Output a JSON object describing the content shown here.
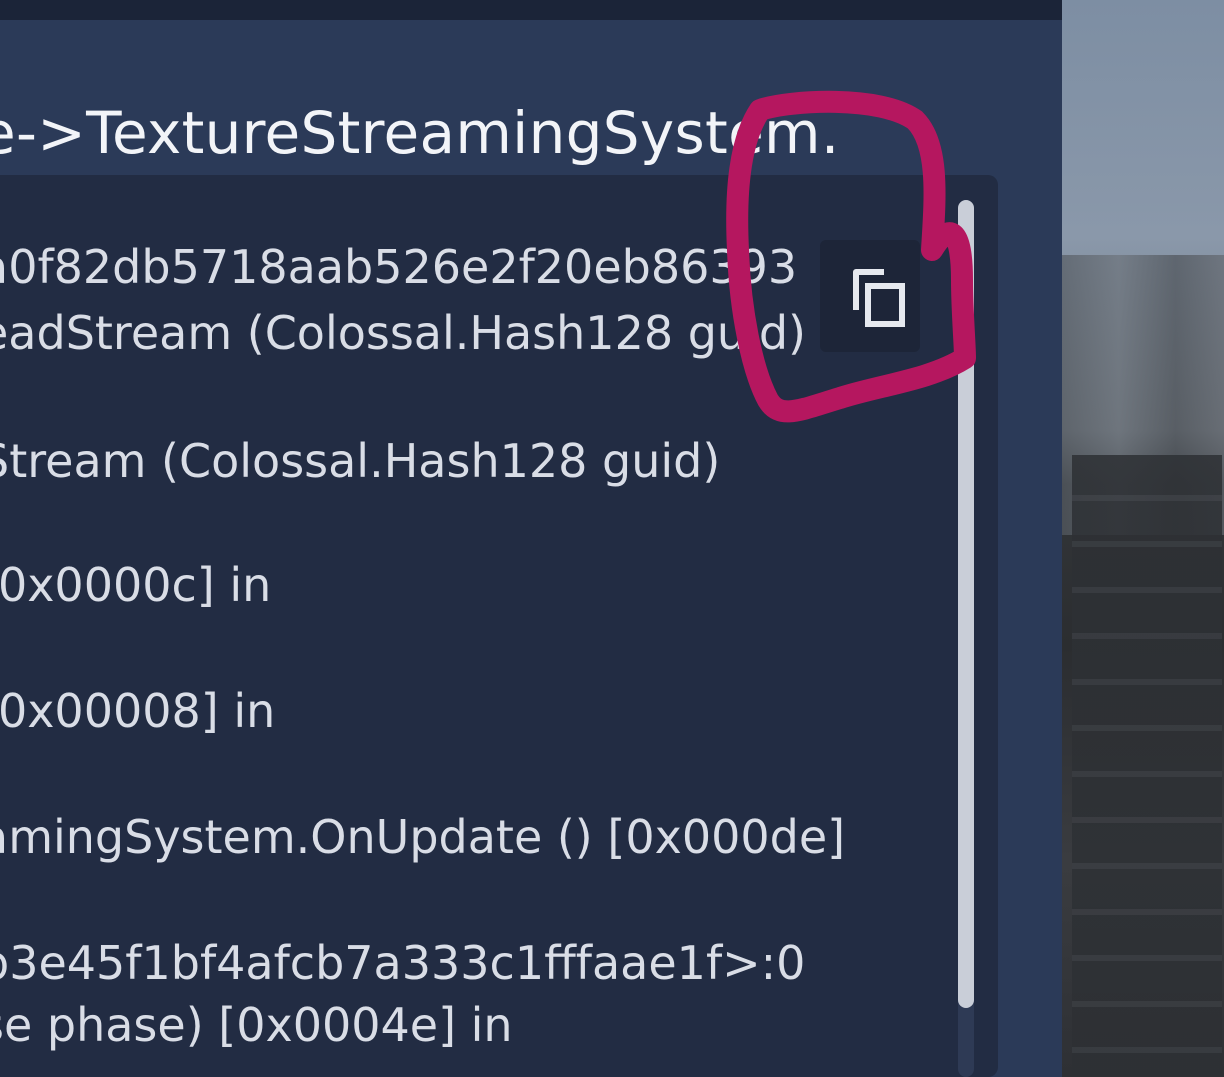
{
  "header": {
    "title": "e->TextureStreamingSystem."
  },
  "log": {
    "lines": [
      "a0f82db5718aab526e2f20eb86393",
      "eadStream (Colossal.Hash128 guid)",
      "Stream (Colossal.Hash128 guid)",
      " [0x0000c] in",
      "[0x00008] in",
      "amingSystem.OnUpdate () [0x000de]",
      "b3e45f1bf4afcb7a333c1fffaae1f>:0",
      "se phase) [0x0004e] in"
    ]
  },
  "icons": {
    "copy": "copy-icon"
  },
  "colors": {
    "panel": "#2b3a58",
    "code_box": "#222c43",
    "annotation": "#b5175f",
    "text": "#d9dde6"
  }
}
